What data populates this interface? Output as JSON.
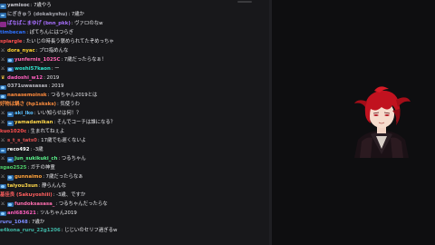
{
  "colors": {
    "chat_bg": "#18181b",
    "page_bg": "#0e0e10"
  },
  "chat": {
    "messages": [
      {
        "name": "yamisoc",
        "name_color": "#c7c7cf",
        "badges": [
          "sub"
        ],
        "text": "7歳やろ"
      },
      {
        "name": "にぎきゅう (dokakyshu)",
        "name_color": "#a9a9b2",
        "badges": [
          "sub"
        ],
        "text": "7歳か"
      },
      {
        "name": "ばなぱこまゆげ (bnn_pkk)",
        "name_color": "#a86fff",
        "badges": [
          "vip"
        ],
        "text": "ヴァロのなw"
      },
      {
        "name": "timbecan",
        "name_color": "#2f72ff",
        "badges": [],
        "text": "ぽてちんにはつらぎ"
      },
      {
        "name": "splargle",
        "name_color": "#ff4e4e",
        "badges": [],
        "text": "たいじの時長う褒められてたぞめっちゃ"
      },
      {
        "name": "dora_nyac",
        "name_color": "#ffd22e",
        "badges": [
          "mod"
        ],
        "text": "プロ指めんな"
      },
      {
        "name": "yunfernis_1025C",
        "name_color": "#ff66b3",
        "badges": [
          "mod",
          "sub"
        ],
        "text": "7歳だったらなぁ！"
      },
      {
        "name": "woshi57kaon",
        "name_color": "#31e7d1",
        "badges": [
          "mod",
          "sub"
        ],
        "text": "ー"
      },
      {
        "name": "dadoshi_w12",
        "name_color": "#ff5fbf",
        "badges": [
          "crown"
        ],
        "text": "2019"
      },
      {
        "name": "0371uwasasas",
        "name_color": "#b8b8c0",
        "badges": [
          "sub"
        ],
        "text": "2019"
      },
      {
        "name": "nanasemoinsk",
        "name_color": "#ff8a3c",
        "badges": [
          "sub"
        ],
        "text": "つるちゃん2019とは"
      },
      {
        "name": "好物は鍋さ (hp1sksks)",
        "name_color": "#ff8f3f",
        "badges": [],
        "text": "気使うわ"
      },
      {
        "name": "aki_lko",
        "name_color": "#5bc0ff",
        "badges": [
          "mod",
          "sub"
        ],
        "text": "いい知らせは何！？"
      },
      {
        "name": "yamadamikan",
        "name_color": "#ffd84a",
        "badges": [
          "mod",
          "sub"
        ],
        "text": "そんでコーチは誰になる？"
      },
      {
        "name": "kuo1020c",
        "name_color": "#ff4e4e",
        "badges": [],
        "text": "生まれてねぇよ"
      },
      {
        "name": "s_t_s_tats0",
        "name_color": "#e05050",
        "badges": [
          "mod"
        ],
        "text": "17歳でも遅くないよ"
      },
      {
        "name": "reco492",
        "name_color": "#ffffff",
        "badges": [
          "sub"
        ],
        "text": "-3歳"
      },
      {
        "name": "Jun_sukikuki_ch",
        "name_color": "#5af08a",
        "badges": [
          "mod",
          "sub"
        ],
        "text": "つるちゃん"
      },
      {
        "name": "sgao2525",
        "name_color": "#4fd06a",
        "badges": [],
        "text": "ガチの神童"
      },
      {
        "name": "gunnaimo",
        "name_color": "#ffa23a",
        "badges": [
          "mod",
          "sub"
        ],
        "text": "7歳だったらなぁ"
      },
      {
        "name": "taiyou3sun",
        "name_color": "#ffd84a",
        "badges": [
          "sub"
        ],
        "text": "静らんんな"
      },
      {
        "name": "基佳良 (Sakuyoshiii)",
        "name_color": "#ff5f5f",
        "badges": [],
        "text": "-3歳、ですか"
      },
      {
        "name": "fundoksasasa_",
        "name_color": "#ff6fb0",
        "badges": [
          "mod",
          "sub"
        ],
        "text": "つるちゃんだったらな"
      },
      {
        "name": "anl683621",
        "name_color": "#ff5fbf",
        "badges": [
          "sub"
        ],
        "text": "ツルちゃん2019"
      },
      {
        "name": "ruru_1048",
        "name_color": "#7c8cff",
        "badges": [],
        "text": "7歳か"
      },
      {
        "name": "e4kona_ruru_22g1206",
        "name_color": "#3fb5a5",
        "badges": [],
        "text": "じじいのセリフ過ぎるw"
      }
    ]
  }
}
